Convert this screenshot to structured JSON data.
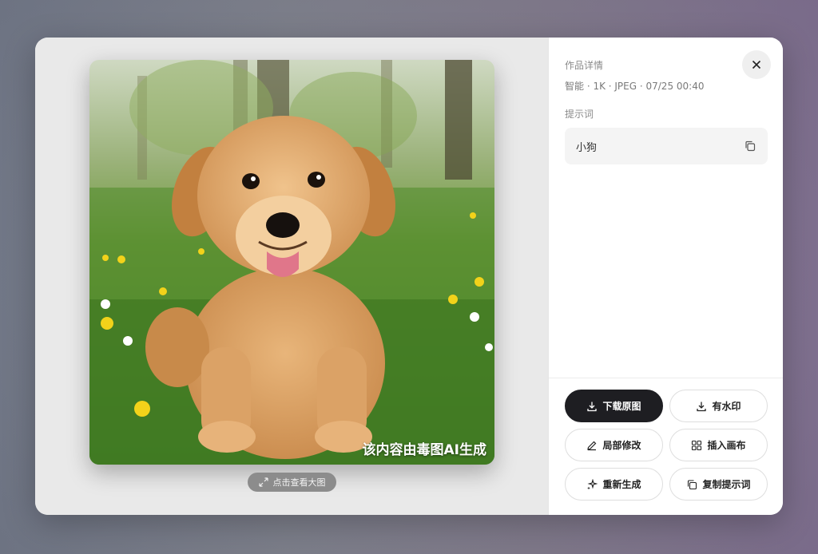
{
  "image": {
    "watermark": "该内容由毒图AI生成",
    "view_large_label": "点击查看大图"
  },
  "details": {
    "section_title": "作品详情",
    "meta": "智能 · 1K · JPEG · 07/25 00:40",
    "prompt_label": "提示词",
    "prompt_text": "小狗"
  },
  "actions": {
    "download_original": "下载原图",
    "with_watermark": "有水印",
    "partial_edit": "局部修改",
    "insert_canvas": "插入画布",
    "regenerate": "重新生成",
    "copy_prompt": "复制提示词"
  },
  "colors": {
    "primary_button": "#1e1e22",
    "modal_bg": "#e8e8e8"
  }
}
